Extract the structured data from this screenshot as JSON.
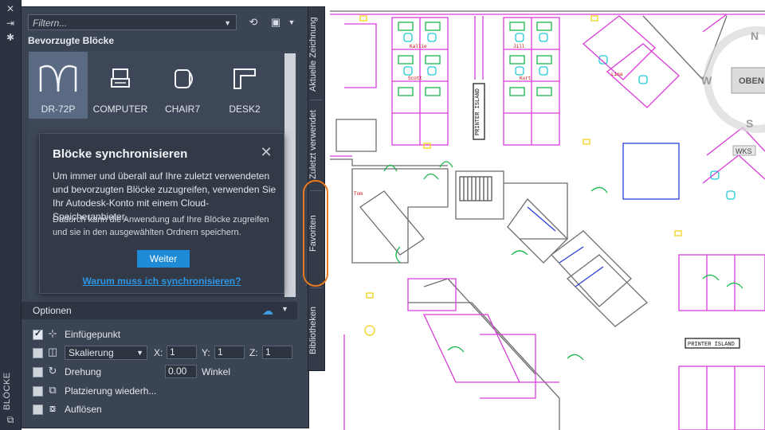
{
  "side_strip": {
    "label": "BLÖCKE"
  },
  "palette": {
    "filter_placeholder": "Filtern...",
    "section_title": "Bevorzugte Blöcke",
    "blocks": [
      {
        "label": "DR-72P",
        "icon": "door-swing-icon",
        "selected": true
      },
      {
        "label": "COMPUTER",
        "icon": "computer-icon",
        "selected": false
      },
      {
        "label": "CHAIR7",
        "icon": "chair-icon",
        "selected": false
      },
      {
        "label": "DESK2",
        "icon": "desk-icon",
        "selected": false
      }
    ]
  },
  "dialog": {
    "title": "Blöcke synchronisieren",
    "text1": "Um immer und überall auf Ihre zuletzt verwendeten und bevorzugten Blöcke zuzugreifen, verwenden Sie Ihr Autodesk-Konto mit einem Cloud-Speicheranbieter.",
    "text2": "Dadurch kann die Anwendung auf Ihre Blöcke zugreifen und sie in den ausgewählten Ordnern speichern.",
    "button": "Weiter",
    "link": "Warum muss ich synchronisieren?"
  },
  "options": {
    "title": "Optionen",
    "insertion_point": {
      "label": "Einfügepunkt",
      "checked": true
    },
    "scale": {
      "mode": "Skalierung",
      "x_label": "X:",
      "x": "1",
      "y_label": "Y:",
      "y": "1",
      "z_label": "Z:",
      "z": "1",
      "checked": false
    },
    "rotation": {
      "label": "Drehung",
      "value": "0.00",
      "unit": "Winkel",
      "checked": false
    },
    "repeat": {
      "label": "Platzierung wiederh...",
      "checked": false
    },
    "explode": {
      "label": "Auflösen",
      "checked": false
    }
  },
  "vertical_tabs": [
    "Aktuelle Zeichnung",
    "Zuletzt verwendet",
    "Favoriten",
    "Bibliotheken"
  ],
  "drawing": {
    "labels": [
      "PRINTER ISLAND",
      "PRINTER ISLAND",
      "WKS"
    ],
    "viewcube": {
      "n": "N",
      "w": "W",
      "s": "S",
      "face": "OBEN"
    }
  },
  "colors": {
    "accent": "#1f8ad6",
    "highlight": "#e8781e",
    "panel": "#3b4453"
  }
}
